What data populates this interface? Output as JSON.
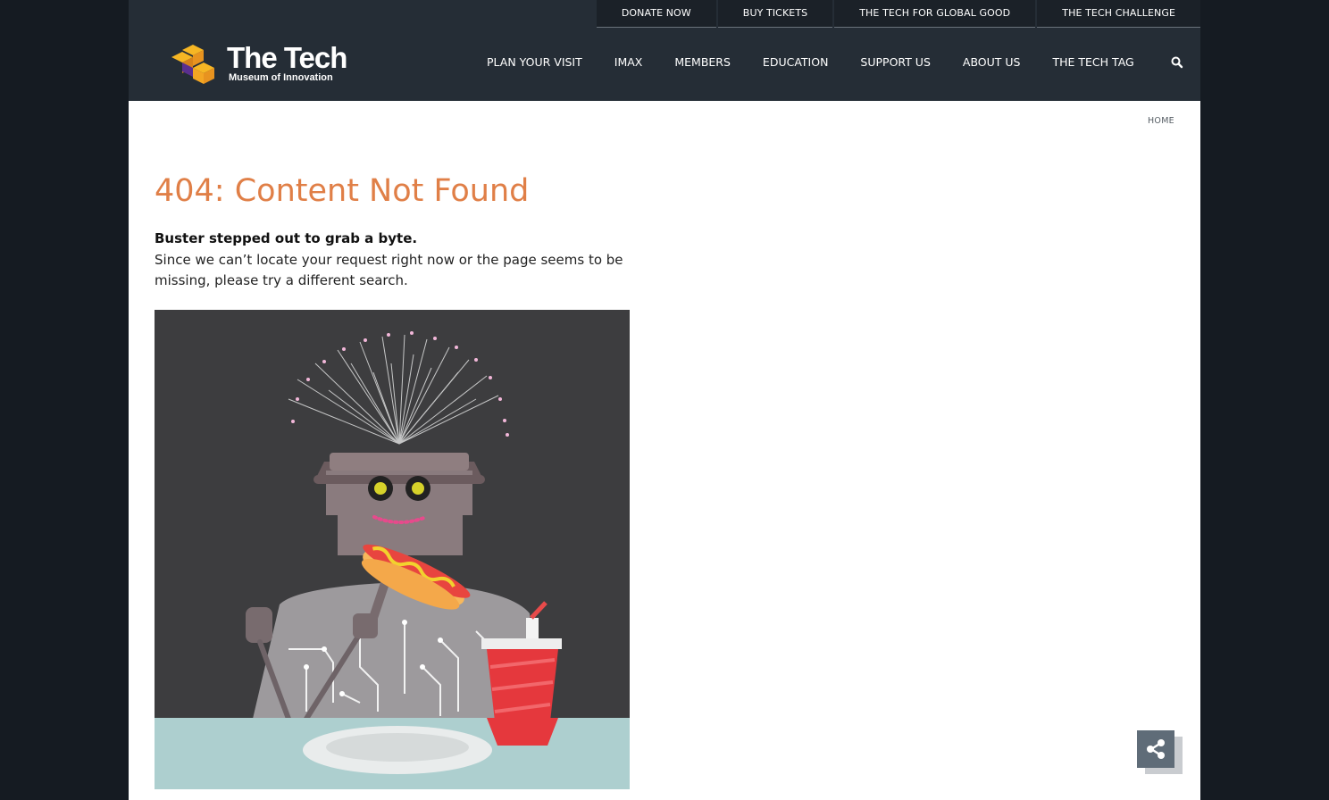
{
  "utility_nav": {
    "items": [
      "DONATE NOW",
      "BUY TICKETS",
      "THE TECH FOR GLOBAL GOOD",
      "THE TECH CHALLENGE"
    ]
  },
  "logo": {
    "name": "The Tech",
    "tagline": "Museum of Innovation"
  },
  "main_nav": {
    "items": [
      "PLAN YOUR VISIT",
      "IMAX",
      "MEMBERS",
      "EDUCATION",
      "SUPPORT US",
      "ABOUT US",
      "THE TECH TAG"
    ]
  },
  "search": {
    "icon": "search-icon"
  },
  "breadcrumb": {
    "home": "HOME"
  },
  "content": {
    "title": "404: Content Not Found",
    "lead": "Buster stepped out to grab a byte.",
    "body": "Since we can’t locate your request right now or the page seems to be missing, please try a different search."
  },
  "share": {
    "icon": "share-icon"
  },
  "colors": {
    "header_bg": "#252d36",
    "title_orange": "#e07f47",
    "outer_bg": "#151b22",
    "share_bg": "#5f6c78"
  }
}
